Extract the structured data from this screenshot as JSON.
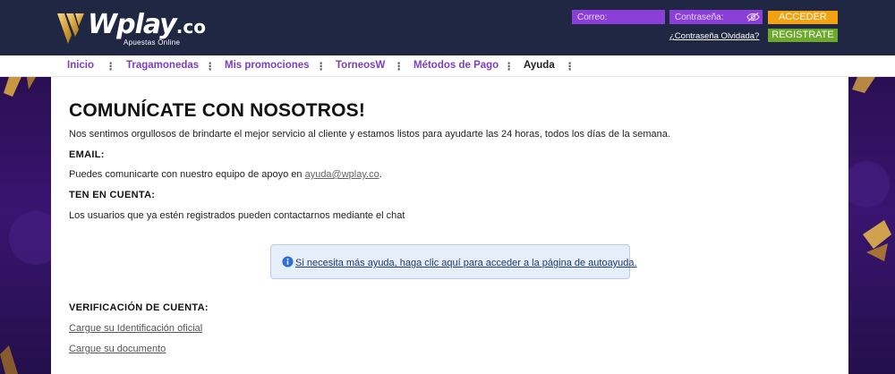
{
  "header": {
    "logo_text": "Wplay",
    "logo_suffix": ".co",
    "logo_tagline": "Apuestas Online",
    "email_placeholder": "Correo:",
    "password_placeholder": "Contraseña:",
    "login_button": "ACCEDER",
    "register_button": "REGISTRATE",
    "forgot_password": "¿Contraseña Olvidada?"
  },
  "nav": {
    "items": [
      {
        "label": "Inicio"
      },
      {
        "label": "Tragamonedas"
      },
      {
        "label": "Mis promociones"
      },
      {
        "label": "TorneosW"
      },
      {
        "label": "Métodos de Pago"
      },
      {
        "label": "Ayuda",
        "active": true
      }
    ],
    "separator": "⋮"
  },
  "main": {
    "title": "COMUNÍCATE CON NOSOTROS!",
    "intro": "Nos sentimos orgullosos de brindarte el mejor servicio al cliente y estamos listos para ayudarte las 24 horas, todos los días de la semana.",
    "email_heading": "EMAIL:",
    "email_text": "Puedes comunicarte con nuestro equipo de apoyo en ",
    "email_address": "ayuda@wplay.co",
    "email_period": ".",
    "notice_heading": "TEN EN CUENTA:",
    "notice_text": "Los usuarios que ya estén registrados pueden contactarnos mediante el chat",
    "help_link": "Si necesita más ayuda, haga clic aquí para acceder a la página de autoayuda.",
    "verification_heading": "VERIFICACIÓN DE CUENTA:",
    "upload_id_link": "Cargue su Identificación oficial",
    "upload_doc_link": "Cargue su documento"
  },
  "colors": {
    "header_bg": "#1f2742",
    "accent_purple": "#7a3fbf",
    "input_purple": "#8b3fd8",
    "login_orange": "#f2a20f",
    "register_green": "#6ca829",
    "info_blue": "#2f6fd0"
  }
}
